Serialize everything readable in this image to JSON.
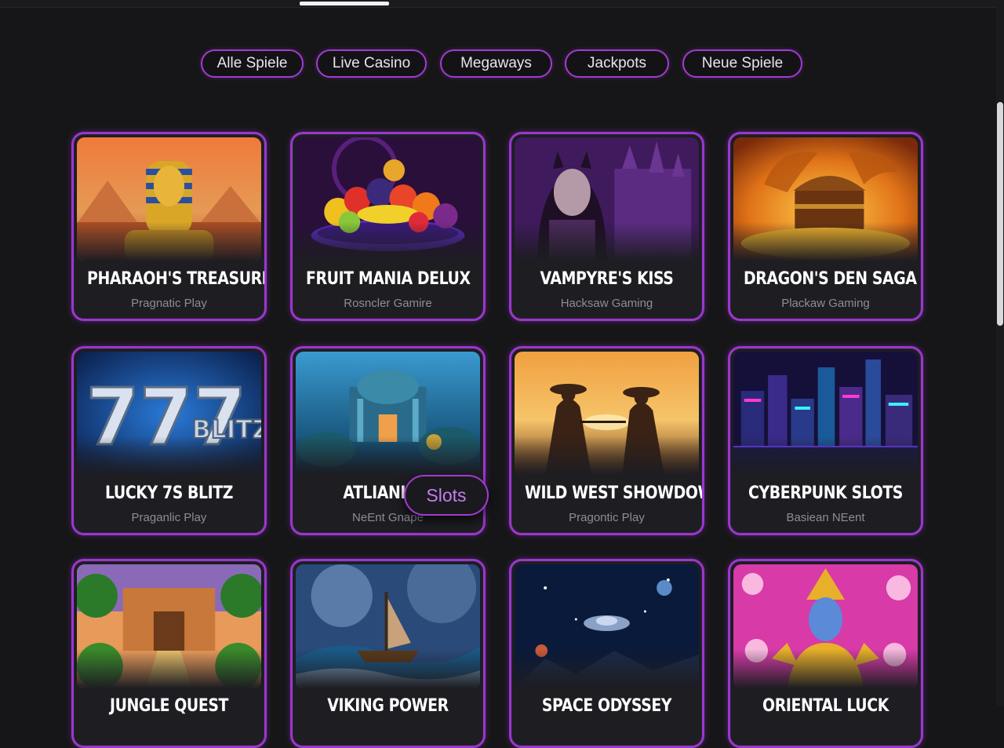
{
  "filters": [
    "Alle Spiele",
    "Live Casino",
    "Megaways",
    "Jackpots",
    "Neue Spiele"
  ],
  "games": [
    {
      "title": "PHARAOH'S TREASURE",
      "provider": "Pragnatic Play",
      "art": "pharaoh-art"
    },
    {
      "title": "FRUIT MANIA DELUX",
      "provider": "Rosncler Gamire",
      "art": "fruit-art"
    },
    {
      "title": "VAMPYRE'S KISS",
      "provider": "Hacksaw Gaming",
      "art": "vampire-art"
    },
    {
      "title": "DRAGON'S DEN SAGA",
      "provider": "Plackaw Gaming",
      "art": "dragon-art"
    },
    {
      "title": "LUCKY 7S BLITZ",
      "provider": "Praganlic Play",
      "art": "sevens-art"
    },
    {
      "title": "ATLIANIS D",
      "provider": "NeEnt Gnape",
      "art": "atlantis-art"
    },
    {
      "title": "WILD WEST SHOWDOWN",
      "provider": "Pragontic Play",
      "art": "western-art"
    },
    {
      "title": "CYBERPUNK SLOTS",
      "provider": "Basiean NEent",
      "art": "cyberpunk-art"
    },
    {
      "title": "JUNGLE QUEST",
      "provider": "",
      "art": "jungle-art"
    },
    {
      "title": "VIKING POWER",
      "provider": "",
      "art": "viking-art"
    },
    {
      "title": "SPACE ODYSSEY",
      "provider": "",
      "art": "space-art"
    },
    {
      "title": "ORIENTAL LUCK",
      "provider": "",
      "art": "oriental-art"
    }
  ],
  "thumb_text": {
    "sevens": "777",
    "blitz": "BLITZ"
  },
  "badge": {
    "label": "Slots"
  },
  "colors": {
    "accent": "#9b36cf",
    "background": "#161618",
    "card": "#1d1d22",
    "badge_text": "#c67cf0"
  }
}
